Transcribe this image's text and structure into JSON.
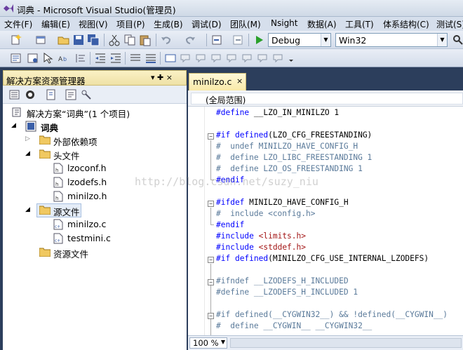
{
  "window": {
    "title": "词典 - Microsoft Visual Studio(管理员)"
  },
  "menu": [
    {
      "label": "文件(F)"
    },
    {
      "label": "编辑(E)"
    },
    {
      "label": "视图(V)"
    },
    {
      "label": "项目(P)"
    },
    {
      "label": "生成(B)"
    },
    {
      "label": "调试(D)"
    },
    {
      "label": "团队(M)"
    },
    {
      "label": "Nsight"
    },
    {
      "label": "数据(A)"
    },
    {
      "label": "工具(T)"
    },
    {
      "label": "体系结构(C)"
    },
    {
      "label": "测试(S)"
    }
  ],
  "toolbar": {
    "configuration": "Debug",
    "platform": "Win32"
  },
  "solution_explorer": {
    "title": "解决方案资源管理器",
    "pin_glyph": "▾ ✚ ×",
    "solution_label": "解决方案“词典”(1 个项目)",
    "project_label": "词典",
    "external_deps": "外部依赖项",
    "headers_folder": "头文件",
    "headers": [
      "lzoconf.h",
      "lzodefs.h",
      "minilzo.h"
    ],
    "sources_folder": "源文件",
    "sources": [
      "minilzo.c",
      "testmini.c"
    ],
    "resources_folder": "资源文件"
  },
  "editor": {
    "tab_label": "minilzo.c",
    "tab_close": "×",
    "scope": "(全局范围)",
    "zoom": "100 %",
    "watermark": "http://blog.csdn.net/suzy_niu"
  },
  "code_lines": [
    {
      "t": "#define __LZO_IN_MINILZO 1",
      "c": "kw0"
    },
    {
      "t": "",
      "c": ""
    },
    {
      "t": "#if defined(LZO_CFG_FREESTANDING)",
      "c": "kw"
    },
    {
      "t": "#  undef MINILZO_HAVE_CONFIG_H",
      "c": "cm"
    },
    {
      "t": "#  define LZO_LIBC_FREESTANDING 1",
      "c": "cm"
    },
    {
      "t": "#  define LZO_OS_FREESTANDING 1",
      "c": "cm"
    },
    {
      "t": "#endif",
      "c": "kw"
    },
    {
      "t": "",
      "c": ""
    },
    {
      "t": "#ifdef MINILZO_HAVE_CONFIG_H",
      "c": "kw"
    },
    {
      "t": "#  include <config.h>",
      "c": "cm"
    },
    {
      "t": "#endif",
      "c": "kw"
    },
    {
      "t": "#include <limits.h>",
      "c": "inc"
    },
    {
      "t": "#include <stddef.h>",
      "c": "inc"
    },
    {
      "t": "#if defined(MINILZO_CFG_USE_INTERNAL_LZODEFS)",
      "c": "kw"
    },
    {
      "t": "",
      "c": ""
    },
    {
      "t": "#ifndef __LZODEFS_H_INCLUDED",
      "c": "cm"
    },
    {
      "t": "#define __LZODEFS_H_INCLUDED 1",
      "c": "cm"
    },
    {
      "t": "",
      "c": ""
    },
    {
      "t": "#if defined(__CYGWIN32__) && !defined(__CYGWIN__)",
      "c": "cm"
    },
    {
      "t": "#  define __CYGWIN__ __CYGWIN32__",
      "c": "cm"
    }
  ]
}
